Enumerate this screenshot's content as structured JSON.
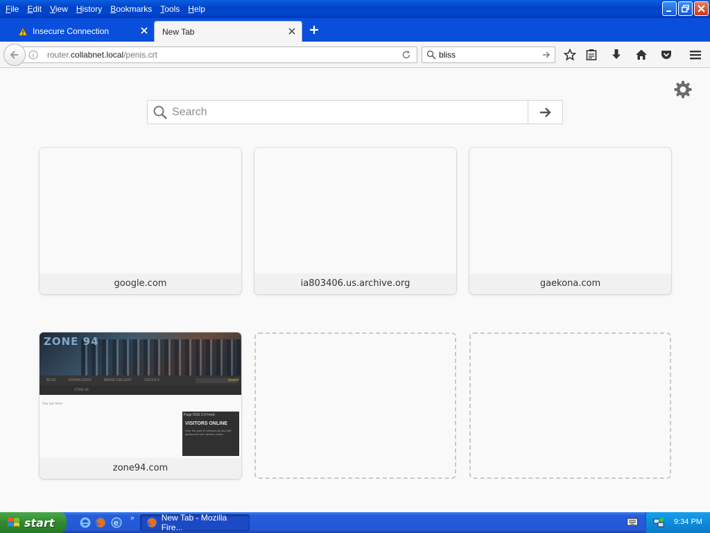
{
  "menu": {
    "items": [
      {
        "label": "File",
        "u": "F",
        "rest": "ile"
      },
      {
        "label": "Edit",
        "u": "E",
        "rest": "dit"
      },
      {
        "label": "View",
        "u": "V",
        "rest": "iew"
      },
      {
        "label": "History",
        "u": "H",
        "rest": "istory"
      },
      {
        "label": "Bookmarks",
        "u": "B",
        "rest": "ookmarks"
      },
      {
        "label": "Tools",
        "u": "T",
        "rest": "ools"
      },
      {
        "label": "Help",
        "u": "H",
        "rest": "elp"
      }
    ]
  },
  "tabs": [
    {
      "label": "Insecure Connection",
      "active": false
    },
    {
      "label": "New Tab",
      "active": true
    }
  ],
  "urlbar": {
    "host_prefix": "router.",
    "host": "collabnet.local",
    "path": "/penis.crt"
  },
  "searchbar": {
    "value": "bliss"
  },
  "page": {
    "search_placeholder": "Search",
    "tiles": [
      {
        "title": "google.com"
      },
      {
        "title": "ia803406.us.archive.org"
      },
      {
        "title": "gaekona.com"
      },
      {
        "title": "zone94.com"
      }
    ],
    "zone94_thumb": {
      "logo": "ZONE 94",
      "nav": [
        "BLOG",
        "DOWNLOADS",
        "IMAGE GALLERY",
        "SOCKS 5"
      ],
      "nav2": "ZONE 94",
      "crumb": "You are here:",
      "search_btn": "Search",
      "rss": "Page RSS 2.0 Feed",
      "visitors_title": "VISITORS ONLINE",
      "visitors_text": "Over the past 15 minutes we had 459 guests and one member online"
    }
  },
  "taskbar": {
    "start_label": "start",
    "task_label": "New Tab - Mozilla Fire...",
    "clock": "9:34 PM"
  },
  "colors": {
    "xp_blue": "#0043c9",
    "start_green": "#2f8a2f",
    "tray_blue": "#0d8bd9"
  }
}
